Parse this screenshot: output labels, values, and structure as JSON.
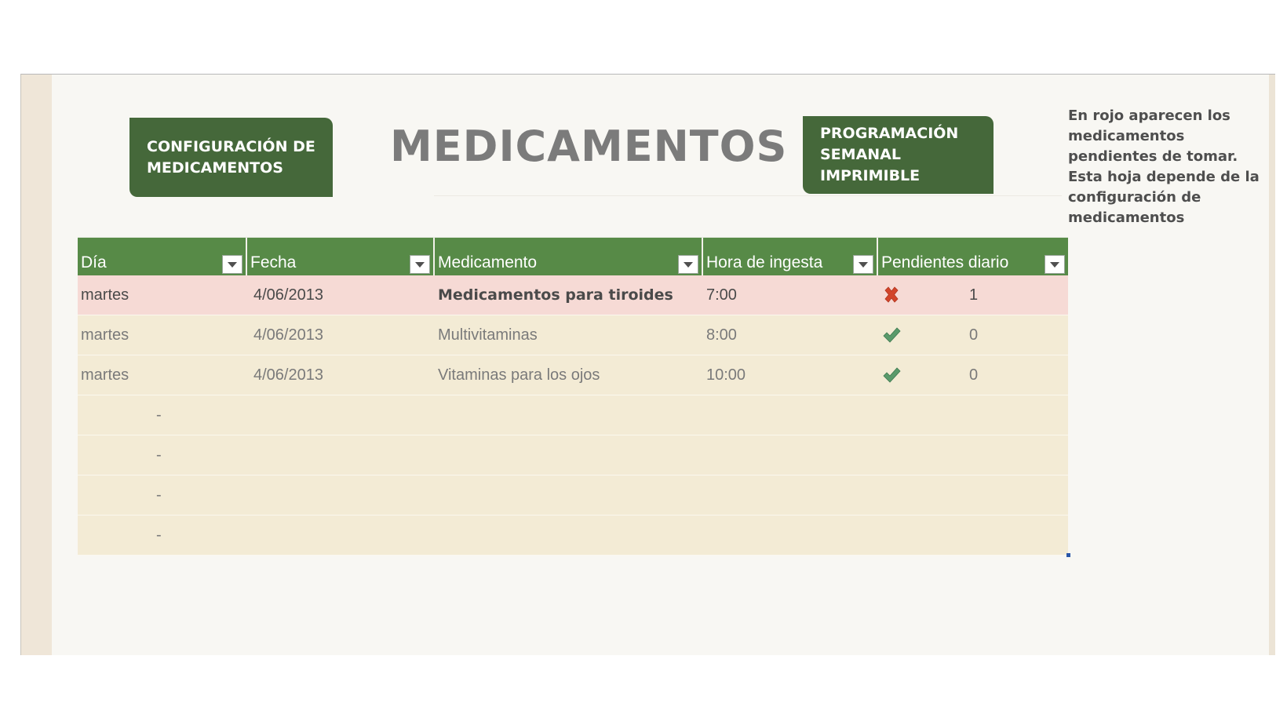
{
  "buttons": {
    "config_label": "CONFIGURACIÓN DE MEDICAMENTOS",
    "prog_label": "PROGRAMACIÓN SEMANAL IMPRIMIBLE"
  },
  "title": "MEDICAMENTOS",
  "note": "En rojo aparecen los medicamentos pendientes de tomar. Esta hoja depende de la configuración de medicamentos",
  "table": {
    "headers": [
      "Día",
      "Fecha",
      "Medicamento",
      "Hora de ingesta",
      "Pendientes diario"
    ],
    "rows": [
      {
        "dia": "martes",
        "fecha": "4/06/2013",
        "medicamento": "Medicamentos para tiroides",
        "hora": "7:00",
        "status": "x-icon",
        "pendientes": "1"
      },
      {
        "dia": "martes",
        "fecha": "4/06/2013",
        "medicamento": "Multivitaminas",
        "hora": "8:00",
        "status": "check-icon",
        "pendientes": "0"
      },
      {
        "dia": "martes",
        "fecha": "4/06/2013",
        "medicamento": "Vitaminas para los ojos",
        "hora": "10:00",
        "status": "check-icon",
        "pendientes": "0"
      }
    ],
    "empty_rows": [
      "-",
      "-",
      "-",
      "-"
    ]
  },
  "colors": {
    "button_green": "#45683a",
    "header_green": "#578a47",
    "pending_row": "#f6dad5",
    "normal_row": "#f3ebd5",
    "x_red": "#d2452b",
    "check_green": "#5a9a6b"
  }
}
